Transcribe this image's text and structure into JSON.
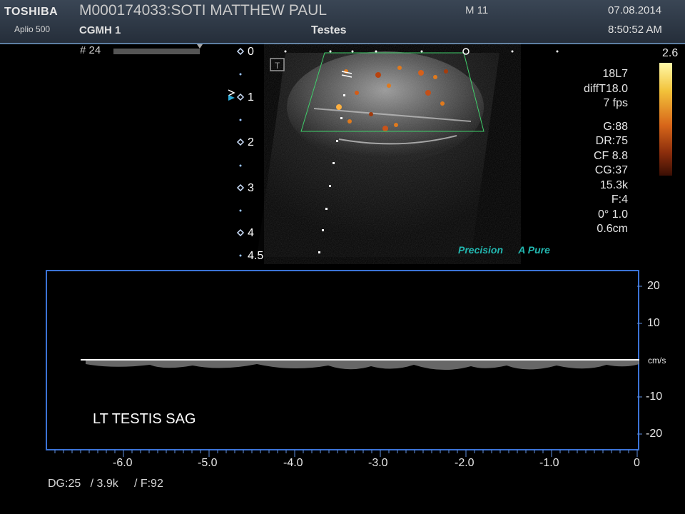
{
  "header": {
    "brand": "TOSHIBA",
    "model": "Aplio 500",
    "patient": "M000174033:SOTI MATTHEW PAUL",
    "hospital": "CGMH 1",
    "exam": "Testes",
    "mode": "M 11",
    "date": "07.08.2014",
    "time": "8:50:52 AM"
  },
  "image": {
    "frame": "# 24",
    "depth_labels": [
      "0",
      "1",
      "2",
      "3",
      "4",
      "4.5"
    ],
    "transducer_icon": "T",
    "params": [
      "18L7",
      "diffT18.0",
      "7 fps",
      "",
      "G:88",
      "DR:75",
      "CF 8.8",
      "CG:37",
      "15.3k",
      "F:4",
      "0°  1.0",
      "0.6cm"
    ],
    "colorbar_max": "2.6",
    "logo_precision": "Precision",
    "logo_apure": "A Pure"
  },
  "doppler": {
    "y_ticks": [
      "20",
      "10",
      "cm/s",
      "-10",
      "-20"
    ],
    "x_ticks": [
      "-6.0",
      "-5.0",
      "-4.0",
      "-3.0",
      "-2.0",
      "-1.0",
      "0"
    ],
    "site_label": "LT TESTIS SAG",
    "bottom_params": "DG:25   / 3.9k     / F:92"
  },
  "colors": {
    "header_bg": "#2e3946",
    "doppler_frame": "#3b73d6",
    "roi_outline": "#3fcf6a",
    "logo_teal": "#22b7b0"
  }
}
